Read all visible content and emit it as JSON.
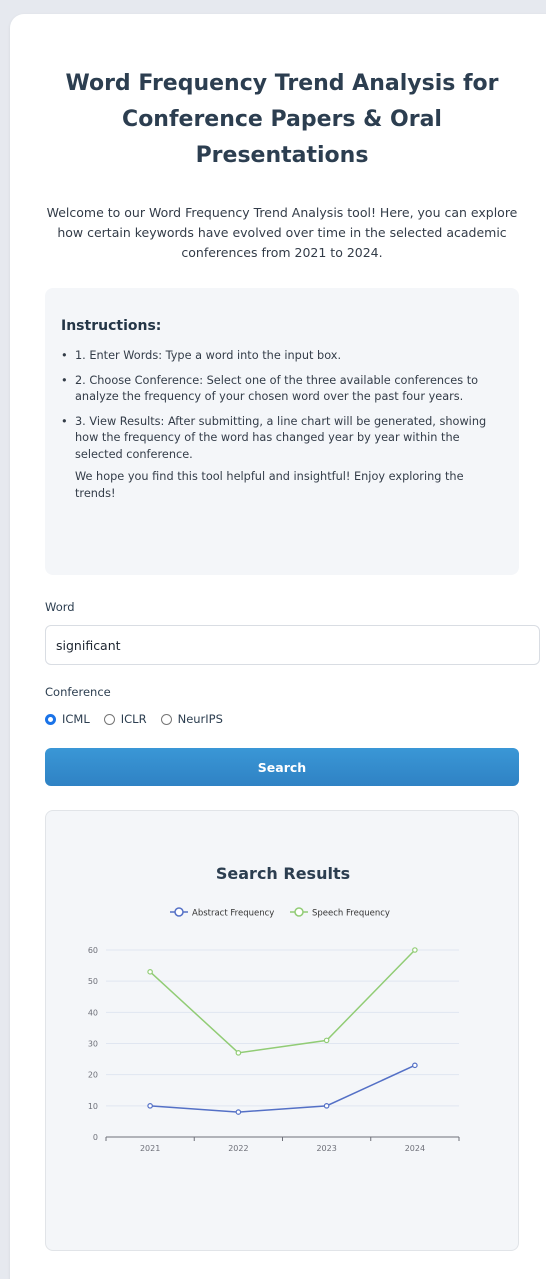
{
  "header": {
    "title": "Word Frequency Trend Analysis for Conference Papers & Oral Presentations",
    "intro": "Welcome to our Word Frequency Trend Analysis tool! Here, you can explore how certain keywords have evolved over time in the selected academic conferences from 2021 to 2024."
  },
  "instructions": {
    "heading": "Instructions:",
    "items": [
      "1. Enter Words: Type a word into the input box.",
      "2. Choose Conference: Select one of the three available conferences to analyze the frequency of your chosen word over the past four years.",
      "3. View Results: After submitting, a line chart will be generated, showing how the frequency of the word has changed year by year within the selected conference."
    ],
    "note": "We hope you find this tool helpful and insightful! Enjoy exploring the trends!"
  },
  "form": {
    "word_label": "Word",
    "word_value": "significant",
    "conference_label": "Conference",
    "conferences": [
      {
        "label": "ICML",
        "checked": true
      },
      {
        "label": "ICLR",
        "checked": false
      },
      {
        "label": "NeurIPS",
        "checked": false
      }
    ],
    "search_label": "Search"
  },
  "colors": {
    "button": "#3a97d6",
    "abstract_series": "#5470c6",
    "speech_series": "#91cc75",
    "title": "#2c3e50"
  },
  "chart_data": {
    "type": "line",
    "title": "Search Results",
    "categories": [
      "2021",
      "2022",
      "2023",
      "2024"
    ],
    "series": [
      {
        "name": "Abstract Frequency",
        "values": [
          10,
          8,
          10,
          23
        ]
      },
      {
        "name": "Speech Frequency",
        "values": [
          53,
          27,
          31,
          60
        ]
      }
    ],
    "ylim": [
      0,
      60
    ],
    "yticks": [
      0,
      10,
      20,
      30,
      40,
      50,
      60
    ],
    "grid": true,
    "legend": "top-center"
  }
}
